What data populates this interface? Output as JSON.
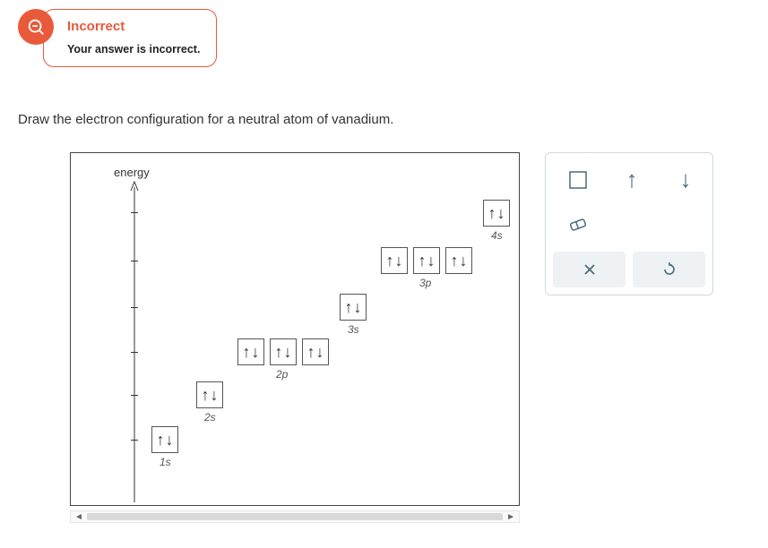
{
  "feedback": {
    "title": "Incorrect",
    "message": "Your answer is incorrect."
  },
  "question": "Draw the electron configuration for a neutral atom of vanadium.",
  "axis_label": "energy",
  "orbitals": {
    "s1": {
      "label": "1s",
      "fill": "↑↓"
    },
    "s2": {
      "label": "2s",
      "fill": "↑↓"
    },
    "p2": {
      "label": "2p",
      "fill": [
        "↑↓",
        "↑↓",
        "↑↓"
      ]
    },
    "s3": {
      "label": "3s",
      "fill": "↑↓"
    },
    "p3": {
      "label": "3p",
      "fill": [
        "↑↓",
        "↑↓",
        "↑↓"
      ]
    },
    "s4": {
      "label": "4s",
      "fill": "↑↓"
    }
  },
  "tools": {
    "box": "empty-box",
    "up": "↑",
    "down": "↓",
    "eraser": "eraser",
    "clear": "×",
    "undo": "↶"
  }
}
